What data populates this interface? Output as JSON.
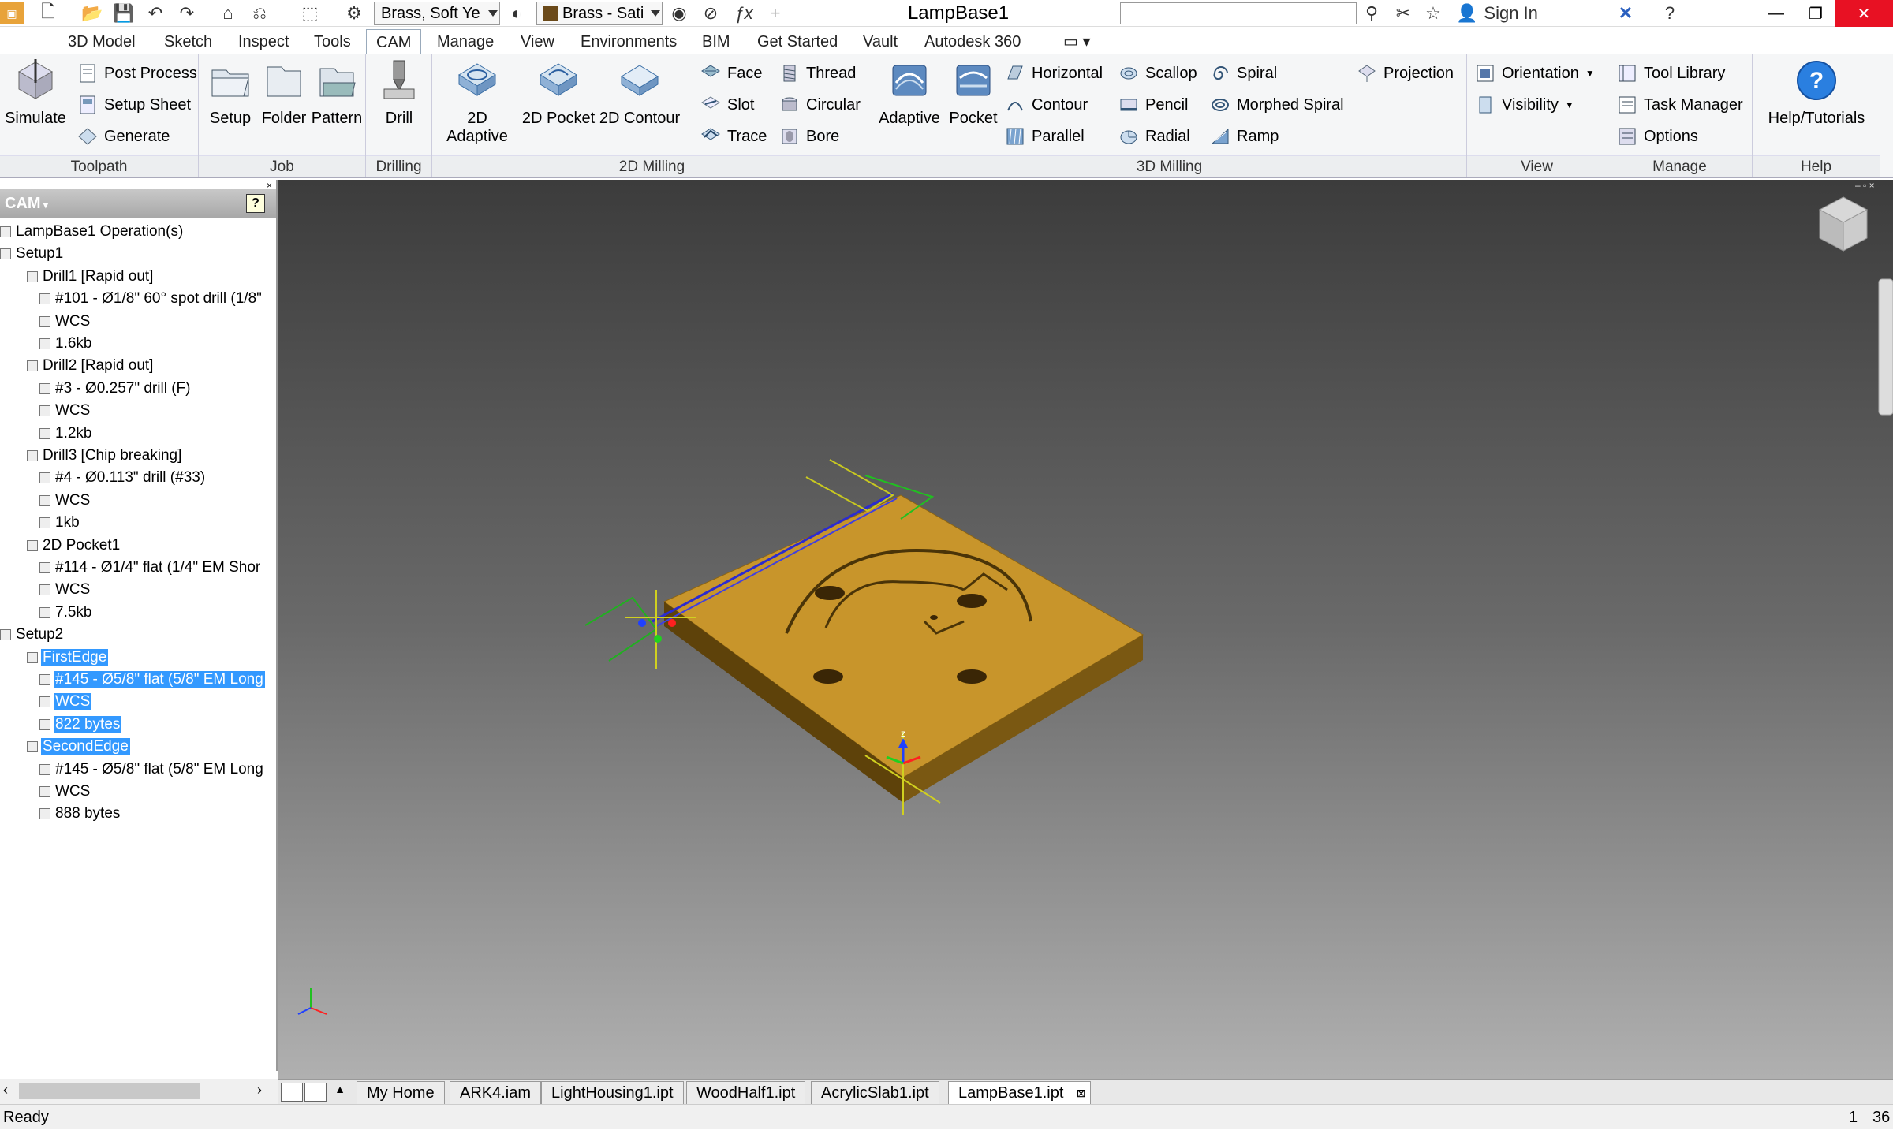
{
  "titlebar": {
    "material": "Brass, Soft Ye",
    "appearance": "Brass - Sati",
    "document_title": "LampBase1",
    "search_placeholder": "",
    "sign_in": "Sign In"
  },
  "tabs": [
    "3D Model",
    "Sketch",
    "Inspect",
    "Tools",
    "CAM",
    "Manage",
    "View",
    "Environments",
    "BIM",
    "Get Started",
    "Vault",
    "Autodesk 360"
  ],
  "active_tab": "CAM",
  "ribbon": {
    "toolpath": {
      "label": "Toolpath",
      "simulate": "Simulate",
      "post_process": "Post Process",
      "setup_sheet": "Setup Sheet",
      "generate": "Generate"
    },
    "job": {
      "label": "Job",
      "setup": "Setup",
      "folder": "Folder",
      "pattern": "Pattern"
    },
    "drilling": {
      "label": "Drilling",
      "drill": "Drill"
    },
    "milling2d": {
      "label": "2D Milling",
      "adaptive": "2D Adaptive",
      "pocket": "2D Pocket",
      "contour": "2D Contour",
      "face": "Face",
      "slot": "Slot",
      "trace": "Trace",
      "thread": "Thread",
      "circular": "Circular",
      "bore": "Bore"
    },
    "milling3d": {
      "label": "3D Milling",
      "adaptive": "Adaptive",
      "pocket": "Pocket",
      "horizontal": "Horizontal",
      "contour": "Contour",
      "parallel": "Parallel",
      "scallop": "Scallop",
      "pencil": "Pencil",
      "radial": "Radial",
      "spiral": "Spiral",
      "morphed_spiral": "Morphed Spiral",
      "ramp": "Ramp",
      "projection": "Projection"
    },
    "view": {
      "label": "View",
      "orientation": "Orientation",
      "visibility": "Visibility"
    },
    "manage": {
      "label": "Manage",
      "tool_library": "Tool Library",
      "task_manager": "Task Manager",
      "options": "Options"
    },
    "help": {
      "label": "Help",
      "help_tutorials": "Help/Tutorials"
    }
  },
  "browser": {
    "title": "CAM",
    "items": [
      {
        "text": "LampBase1 Operation(s)",
        "level": 0,
        "selected": false
      },
      {
        "text": "Setup1",
        "level": 0,
        "selected": false
      },
      {
        "text": "Drill1 [Rapid out]",
        "level": 1,
        "selected": false
      },
      {
        "text": "#101 - Ø1/8\" 60° spot drill (1/8\"",
        "level": 2,
        "selected": false
      },
      {
        "text": "WCS",
        "level": 2,
        "selected": false
      },
      {
        "text": "1.6kb",
        "level": 2,
        "selected": false
      },
      {
        "text": "Drill2 [Rapid out]",
        "level": 1,
        "selected": false
      },
      {
        "text": "#3 - Ø0.257\" drill (F)",
        "level": 2,
        "selected": false
      },
      {
        "text": "WCS",
        "level": 2,
        "selected": false
      },
      {
        "text": "1.2kb",
        "level": 2,
        "selected": false
      },
      {
        "text": "Drill3 [Chip breaking]",
        "level": 1,
        "selected": false
      },
      {
        "text": "#4 - Ø0.113\" drill (#33)",
        "level": 2,
        "selected": false
      },
      {
        "text": "WCS",
        "level": 2,
        "selected": false
      },
      {
        "text": "1kb",
        "level": 2,
        "selected": false
      },
      {
        "text": "2D Pocket1",
        "level": 1,
        "selected": false
      },
      {
        "text": "#114 - Ø1/4\" flat (1/4\" EM Shor",
        "level": 2,
        "selected": false
      },
      {
        "text": "WCS",
        "level": 2,
        "selected": false
      },
      {
        "text": "7.5kb",
        "level": 2,
        "selected": false
      },
      {
        "text": "Setup2",
        "level": 0,
        "selected": false
      },
      {
        "text": "FirstEdge",
        "level": 1,
        "selected": true
      },
      {
        "text": "#145 - Ø5/8\" flat (5/8\" EM Long",
        "level": 2,
        "selected": true
      },
      {
        "text": "WCS",
        "level": 2,
        "selected": true
      },
      {
        "text": "822 bytes",
        "level": 2,
        "selected": true
      },
      {
        "text": "SecondEdge",
        "level": 1,
        "selected": true
      },
      {
        "text": "#145 - Ø5/8\" flat (5/8\" EM Long",
        "level": 2,
        "selected": false
      },
      {
        "text": "WCS",
        "level": 2,
        "selected": false
      },
      {
        "text": "888 bytes",
        "level": 2,
        "selected": false
      }
    ]
  },
  "doc_tabs": [
    "My Home",
    "ARK4.iam",
    "LightHousing1.ipt",
    "WoodHalf1.ipt",
    "AcrylicSlab1.ipt",
    "LampBase1.ipt"
  ],
  "active_doc": "LampBase1.ipt",
  "status": {
    "text": "Ready",
    "n1": "1",
    "n2": "36"
  },
  "colors": {
    "selection": "#3399ff",
    "part": "#c8952b",
    "viewport_top": "#3c3c3c",
    "viewport_bottom": "#b0b0b0"
  }
}
